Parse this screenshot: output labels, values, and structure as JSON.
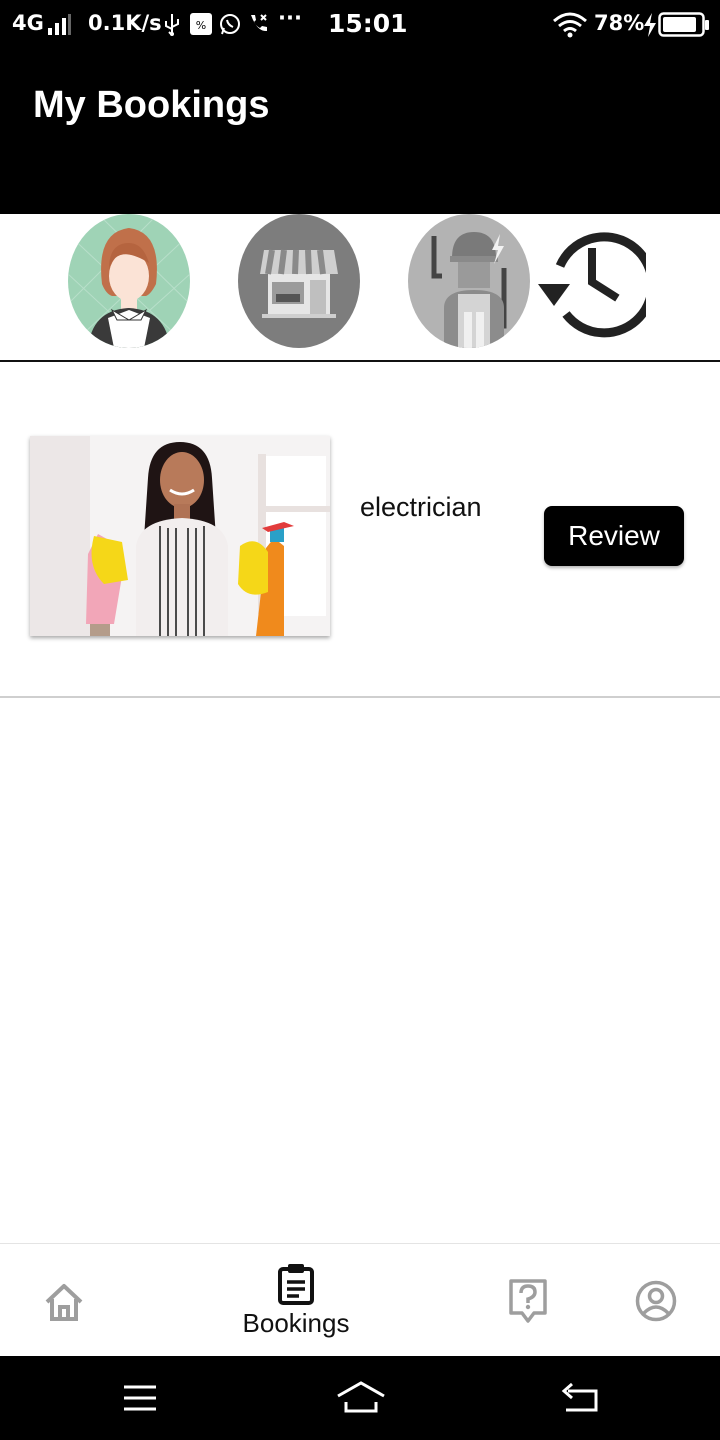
{
  "status_bar": {
    "network": "4G",
    "speed": "0.1K/s",
    "time": "15:01",
    "battery": "78%"
  },
  "header": {
    "title": "My Bookings"
  },
  "categories": [
    {
      "name": "maid",
      "icon": "maid-avatar-icon"
    },
    {
      "name": "shop",
      "icon": "storefront-icon"
    },
    {
      "name": "electrician",
      "icon": "electrician-icon"
    },
    {
      "name": "history",
      "icon": "history-clock-icon"
    }
  ],
  "booking": {
    "service_name": "electrician",
    "review_label": "Review",
    "image": "cleaning-woman-photo"
  },
  "bottom_nav": {
    "items": [
      {
        "icon": "home-icon",
        "label": ""
      },
      {
        "icon": "clipboard-icon",
        "label": "Bookings",
        "active": true
      },
      {
        "icon": "help-icon",
        "label": ""
      },
      {
        "icon": "profile-icon",
        "label": ""
      }
    ]
  },
  "colors": {
    "header_bg": "#000000",
    "inactive_icon": "#9e9e9e",
    "active_icon": "#111111"
  }
}
